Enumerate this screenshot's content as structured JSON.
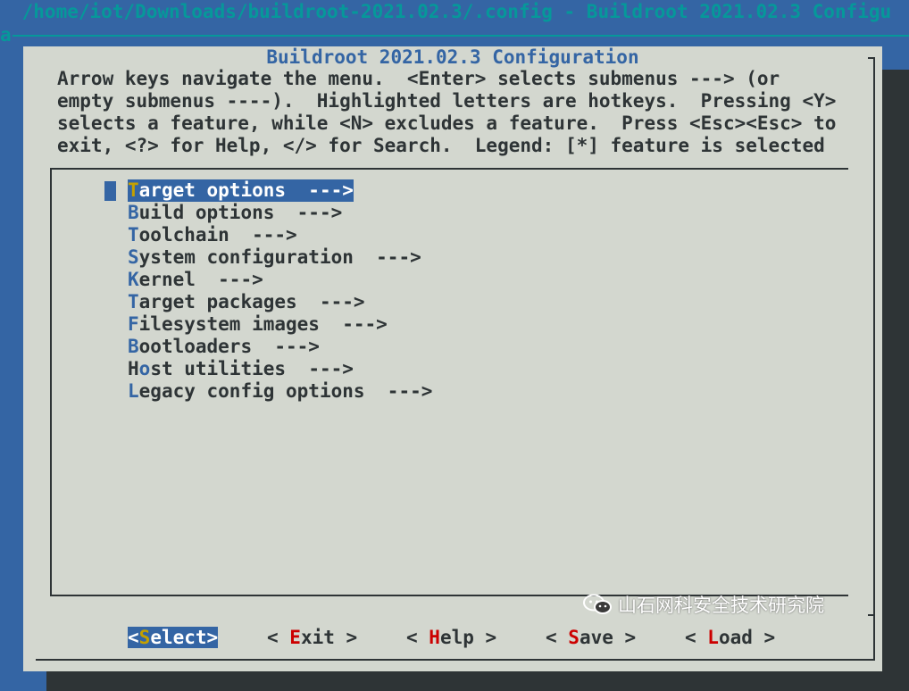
{
  "window": {
    "title": " /home/iot/Downloads/buildroot-2021.02.3/.config - Buildroot 2021.02.3 Configu",
    "title_wrap": "a"
  },
  "dialog": {
    "title": "Buildroot 2021.02.3 Configuration",
    "help_lines": [
      "Arrow keys navigate the menu.  <Enter> selects submenus ---> (or",
      "empty submenus ----).  Highlighted letters are hotkeys.  Pressing <Y>",
      "selects a feature, while <N> excludes a feature.  Press <Esc><Esc> to",
      "exit, <?> for Help, </> for Search.  Legend: [*] feature is selected"
    ]
  },
  "menu": {
    "items": [
      {
        "hotkey": "T",
        "rest": "arget options  --->",
        "selected": true
      },
      {
        "hotkey": "B",
        "rest": "uild options  --->",
        "selected": false
      },
      {
        "hotkey": "T",
        "rest": "oolchain  --->",
        "selected": false
      },
      {
        "hotkey": "S",
        "rest": "ystem configuration  --->",
        "selected": false
      },
      {
        "hotkey": "K",
        "rest": "ernel  --->",
        "selected": false
      },
      {
        "hotkey": "T",
        "rest": "arget packages  --->",
        "selected": false
      },
      {
        "hotkey": "F",
        "rest": "ilesystem images  --->",
        "selected": false
      },
      {
        "hotkey": "B",
        "rest": "ootloaders  --->",
        "selected": false
      },
      {
        "pre": "H",
        "hotkey": "o",
        "rest": "st utilities  --->",
        "selected": false
      },
      {
        "hotkey": "L",
        "rest": "egacy config options  --->",
        "selected": false
      }
    ]
  },
  "buttons": {
    "select": {
      "pre": "<",
      "hotkey": "S",
      "post": "elect>"
    },
    "exit": {
      "pre": "< ",
      "hotkey": "E",
      "post": "xit >"
    },
    "help": {
      "pre": "< ",
      "hotkey": "H",
      "post": "elp >"
    },
    "save": {
      "pre": "< ",
      "hotkey": "S",
      "post": "ave >"
    },
    "load": {
      "pre": "< ",
      "hotkey": "L",
      "post": "oad >"
    }
  },
  "watermark": {
    "icon": "wechat-icon",
    "text": "山石网科安全技术研究院"
  },
  "colors": {
    "background": "#3465a4",
    "dialog": "#d3d7cf",
    "highlight": "#3465a4",
    "hotkey_selected": "#c4a000",
    "button_hotkey": "#cc0000",
    "title_text": "#06989a"
  }
}
